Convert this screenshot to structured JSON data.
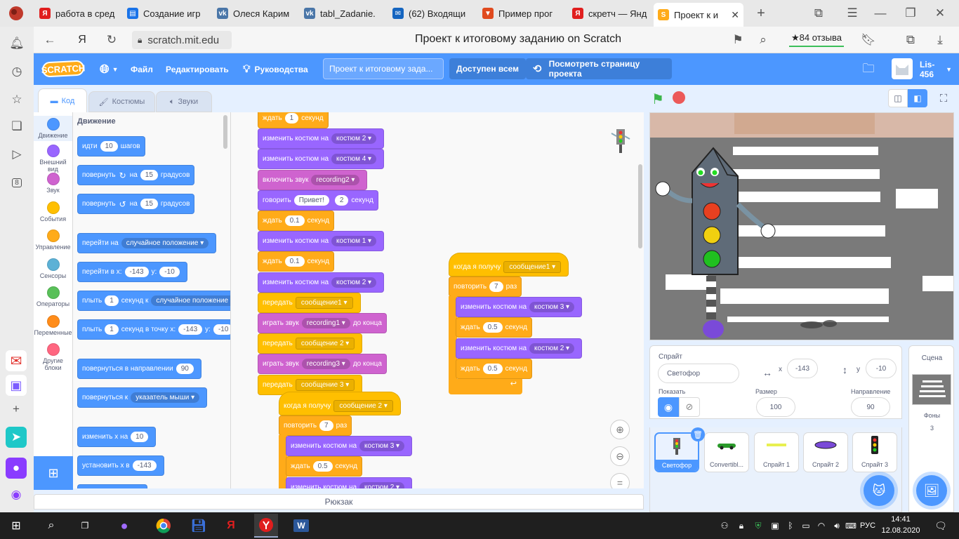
{
  "tabs": [
    {
      "label": "работа в сред",
      "fav_color": "#e01e1e",
      "fav": "Я"
    },
    {
      "label": "Создание игр",
      "fav_color": "#1a73e8",
      "fav": "▤"
    },
    {
      "label": "Олеся Карим",
      "fav_color": "#4a76a8",
      "fav": "vk"
    },
    {
      "label": "tabl_Zadanie.",
      "fav_color": "#4a76a8",
      "fav": "vk"
    },
    {
      "label": "(62) Входящи",
      "fav_color": "#1565c0",
      "fav": "✉"
    },
    {
      "label": "Пример прог",
      "fav_color": "#e04a1e",
      "fav": "▼"
    },
    {
      "label": "скретч — Янд",
      "fav_color": "#e01e1e",
      "fav": "Я"
    },
    {
      "label": "Проект к и",
      "fav_color": "#ffab19",
      "fav": "S"
    }
  ],
  "address": {
    "url": "scratch.mit.edu",
    "page_title": "Проект к итоговому заданию on Scratch",
    "reviews": "★84 отзыва"
  },
  "menu": {
    "logo": "SCRATCH",
    "file": "Файл",
    "edit": "Редактировать",
    "tutorials": "Руководства",
    "project_title": "Проект к итоговому зада...",
    "share": "Доступен всем",
    "see_page": "Посмотреть страницу проекта",
    "username": "Lis-456"
  },
  "editor_tabs": {
    "code": "Код",
    "costumes": "Костюмы",
    "sounds": "Звуки"
  },
  "categories": [
    {
      "label": "Движение",
      "color": "#4c97ff"
    },
    {
      "label": "Внешний вид",
      "color": "#9966ff"
    },
    {
      "label": "Звук",
      "color": "#cf63cf"
    },
    {
      "label": "События",
      "color": "#ffbf00"
    },
    {
      "label": "Управление",
      "color": "#ffab19"
    },
    {
      "label": "Сенсоры",
      "color": "#5cb1d6"
    },
    {
      "label": "Операторы",
      "color": "#59c059"
    },
    {
      "label": "Переменные",
      "color": "#ff8c1a"
    },
    {
      "label": "Другие блоки",
      "color": "#ff6680"
    }
  ],
  "palette": {
    "heading": "Движение",
    "b1": {
      "a": "идти",
      "v": "10",
      "b": "шагов"
    },
    "b2": {
      "a": "повернуть",
      "b": "на",
      "v": "15",
      "c": "градусов"
    },
    "b3": {
      "a": "повернуть",
      "b": "на",
      "v": "15",
      "c": "градусов"
    },
    "b4": {
      "a": "перейти на",
      "d": "случайное положение"
    },
    "b5": {
      "a": "перейти в x:",
      "x": "-143",
      "b": "y:",
      "y": "-10"
    },
    "b6": {
      "a": "плыть",
      "v": "1",
      "b": "секунд к",
      "d": "случайное положение"
    },
    "b7": {
      "a": "плыть",
      "v": "1",
      "b": "секунд в точку x:",
      "x": "-143",
      "c": "y:",
      "y": "-10"
    },
    "b8": {
      "a": "повернуться в направлении",
      "v": "90"
    },
    "b9": {
      "a": "повернуться к",
      "d": "указатель мыши"
    },
    "b10": {
      "a": "изменить x на",
      "v": "10"
    },
    "b11": {
      "a": "установить x в",
      "v": "-143"
    }
  },
  "script1": [
    {
      "kind": "co",
      "a": "ждать",
      "v": "1",
      "b": "секунд"
    },
    {
      "kind": "lo",
      "a": "изменить костюм на",
      "d": "костюм 2"
    },
    {
      "kind": "lo",
      "a": "изменить костюм на",
      "d": "костюм 4"
    },
    {
      "kind": "so",
      "a": "включить звук",
      "d": "recording2"
    },
    {
      "kind": "lo",
      "a": "говорить",
      "v": "Привет!",
      "v2": "2",
      "b": "секунд"
    },
    {
      "kind": "co",
      "a": "ждать",
      "v": "0.1",
      "b": "секунд"
    },
    {
      "kind": "lo",
      "a": "изменить костюм на",
      "d": "костюм 1"
    },
    {
      "kind": "co",
      "a": "ждать",
      "v": "0.1",
      "b": "секунд"
    },
    {
      "kind": "lo",
      "a": "изменить костюм на",
      "d": "костюм 2"
    },
    {
      "kind": "ev",
      "a": "передать",
      "d": "сообщение1"
    },
    {
      "kind": "so",
      "a": "играть звук",
      "d": "recording1",
      "b": "до конца"
    },
    {
      "kind": "ev",
      "a": "передать",
      "d": "сообщение 2"
    },
    {
      "kind": "so",
      "a": "играть звук",
      "d": "recording3",
      "b": "до конца"
    },
    {
      "kind": "ev",
      "a": "передать",
      "d": "сообщение 3"
    }
  ],
  "script2": {
    "hat": "когда я получу",
    "hat_d": "сообщение 2",
    "rep": "повторить",
    "rep_v": "7",
    "rep_b": "раз",
    "inner": [
      {
        "kind": "lo",
        "a": "изменить костюм на",
        "d": "костюм 3"
      },
      {
        "kind": "co",
        "a": "ждать",
        "v": "0.5",
        "b": "секунд"
      },
      {
        "kind": "lo",
        "a": "изменить костюм на",
        "d": "костюм 2"
      }
    ]
  },
  "script3": {
    "hat": "когда я получу",
    "hat_d": "сообщение1",
    "rep": "повторить",
    "rep_v": "7",
    "rep_b": "раз",
    "inner": [
      {
        "kind": "lo",
        "a": "изменить костюм на",
        "d": "костюм 3"
      },
      {
        "kind": "co",
        "a": "ждать",
        "v": "0.5",
        "b": "секунд"
      },
      {
        "kind": "lo",
        "a": "изменить костюм на",
        "d": "костюм 2"
      },
      {
        "kind": "co",
        "a": "ждать",
        "v": "0.5",
        "b": "секунд"
      }
    ]
  },
  "backpack": "Рюкзак",
  "sprite_info": {
    "label": "Спрайт",
    "name": "Светофор",
    "x_label": "x",
    "x": "-143",
    "y_label": "y",
    "y": "-10",
    "show": "Показать",
    "size_label": "Размер",
    "size": "100",
    "dir_label": "Направление",
    "dir": "90"
  },
  "sprites": [
    {
      "name": "Светофор"
    },
    {
      "name": "Convertibl..."
    },
    {
      "name": "Спрайт 1"
    },
    {
      "name": "Спрайт 2"
    },
    {
      "name": "Спрайт 3"
    }
  ],
  "stage_panel": {
    "label": "Сцена",
    "backdrops_label": "Фоны",
    "backdrops": "3"
  },
  "taskbar": {
    "lang": "РУС",
    "time": "14:41",
    "date": "12.08.2020"
  }
}
